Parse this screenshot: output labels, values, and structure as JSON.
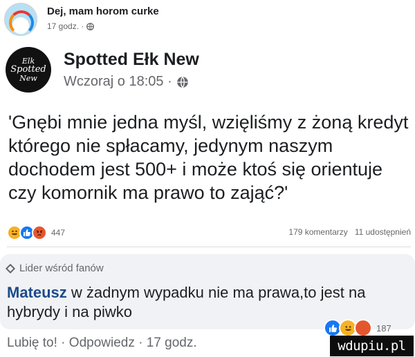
{
  "outer_post": {
    "author": "Dej, mam horom curke",
    "time": "17 godz. ·",
    "privacy_icon": "globe-icon"
  },
  "shared_post": {
    "avatar_lines": [
      "Elk",
      "Spotted",
      "New"
    ],
    "author": "Spotted Ełk New",
    "time": "Wczoraj o 18:05 ·",
    "privacy_icon": "globe-icon",
    "text": "'Gnębi mnie jedna myśl, wzięliśmy z żoną kredyt którego nie spłacamy, jedynym naszym dochodem jest 500+ i może ktoś się orientuje czy komornik ma prawo to zająć?'"
  },
  "reactions": {
    "icons": [
      "haha",
      "like",
      "angry"
    ],
    "count": "447"
  },
  "stats": {
    "comments": "179 komentarzy",
    "shares": "11 udostępnień"
  },
  "comment": {
    "badge": "Lider wśród fanów",
    "author": "Mateusz",
    "text": " w żadnym wypadku nie ma prawa,to jest na hybrydy i na piwko",
    "reaction_count": "187"
  },
  "actions": {
    "like": "Lubię to!",
    "sep1": " · ",
    "reply": "Odpowiedz",
    "sep2": " · ",
    "time": "17 godz."
  },
  "watermark": "wdupiu.pl",
  "colors": {
    "author_blue": "#1c4a8a",
    "like_blue": "#1877f2",
    "haha_yellow": "#f7b125",
    "angry_orange": "#e4572e",
    "comment_bg": "#f0f2f5"
  }
}
